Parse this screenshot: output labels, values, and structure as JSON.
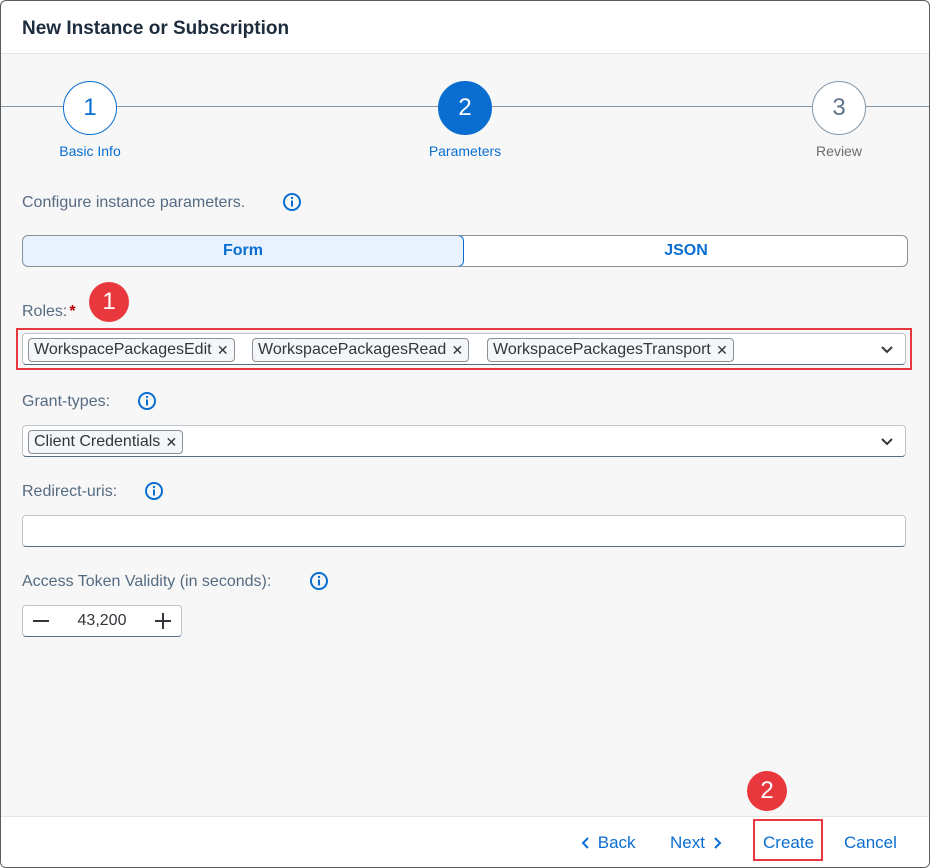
{
  "dialog": {
    "title": "New Instance or Subscription"
  },
  "wizard": {
    "steps": [
      {
        "number": "1",
        "label": "Basic Info",
        "state": "done"
      },
      {
        "number": "2",
        "label": "Parameters",
        "state": "active"
      },
      {
        "number": "3",
        "label": "Review",
        "state": "todo"
      }
    ]
  },
  "form": {
    "description": "Configure instance parameters.",
    "mode_tabs": {
      "form": "Form",
      "json": "JSON",
      "selected": "Form"
    },
    "roles": {
      "label": "Roles:",
      "required_marker": "*",
      "tokens": [
        "WorkspacePackagesEdit",
        "WorkspacePackagesRead",
        "WorkspacePackagesTransport"
      ]
    },
    "grant_types": {
      "label": "Grant-types:",
      "tokens": [
        "Client Credentials"
      ]
    },
    "redirect_uris": {
      "label": "Redirect-uris:",
      "value": ""
    },
    "access_token_validity": {
      "label": "Access Token Validity (in seconds):",
      "value": "43,200"
    }
  },
  "annotations": {
    "badge1": "1",
    "badge2": "2"
  },
  "footer": {
    "back": "Back",
    "next": "Next",
    "create": "Create",
    "cancel": "Cancel"
  },
  "colors": {
    "accent": "#0a6ed1",
    "highlight": "#e8383d",
    "required": "#bb0000"
  },
  "icons": {
    "info": "info-circle-icon",
    "dropdown": "chevron-down-icon",
    "remove_token": "close-icon",
    "decrement": "minus-icon",
    "increment": "plus-icon",
    "back": "chevron-left-icon",
    "next": "chevron-right-icon"
  }
}
